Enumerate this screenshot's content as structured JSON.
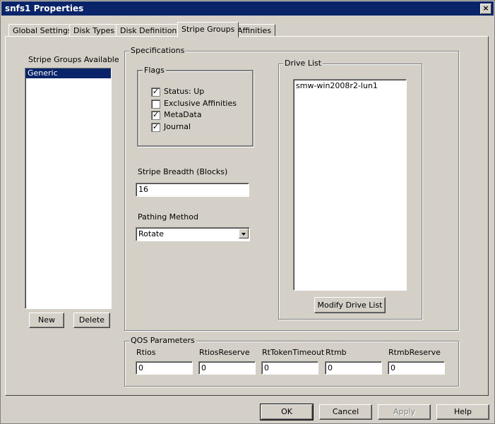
{
  "window": {
    "title": "snfs1 Properties"
  },
  "tabs": [
    "Global Settings",
    "Disk Types",
    "Disk Definitions",
    "Stripe Groups",
    "Affinities"
  ],
  "left": {
    "label": "Stripe Groups Available",
    "items": [
      "Generic"
    ],
    "new_label": "New",
    "delete_label": "Delete"
  },
  "specifications": {
    "legend": "Specifications",
    "flags": {
      "legend": "Flags",
      "items": [
        {
          "label": "Status: Up",
          "checked": true,
          "mark": "✓"
        },
        {
          "label": "Exclusive Affinities",
          "checked": false,
          "mark": ""
        },
        {
          "label": "MetaData",
          "checked": true,
          "mark": "✓"
        },
        {
          "label": "Journal",
          "checked": true,
          "mark": "✓"
        }
      ]
    },
    "stripe_breadth_label": "Stripe Breadth (Blocks)",
    "stripe_breadth_value": "16",
    "pathing_label": "Pathing Method",
    "pathing_value": "Rotate",
    "drive_list": {
      "legend": "Drive List",
      "items": [
        "smw-win2008r2-lun1"
      ],
      "modify_label": "Modify Drive List"
    }
  },
  "qos": {
    "legend": "QOS Parameters",
    "fields": [
      {
        "label": "Rtios",
        "value": "0"
      },
      {
        "label": "RtiosReserve",
        "value": "0"
      },
      {
        "label": "RtTokenTimeout",
        "value": "0"
      },
      {
        "label": "Rtmb",
        "value": "0"
      },
      {
        "label": "RtmbReserve",
        "value": "0"
      }
    ]
  },
  "footer": {
    "ok": "OK",
    "cancel": "Cancel",
    "apply": "Apply",
    "help": "Help"
  }
}
